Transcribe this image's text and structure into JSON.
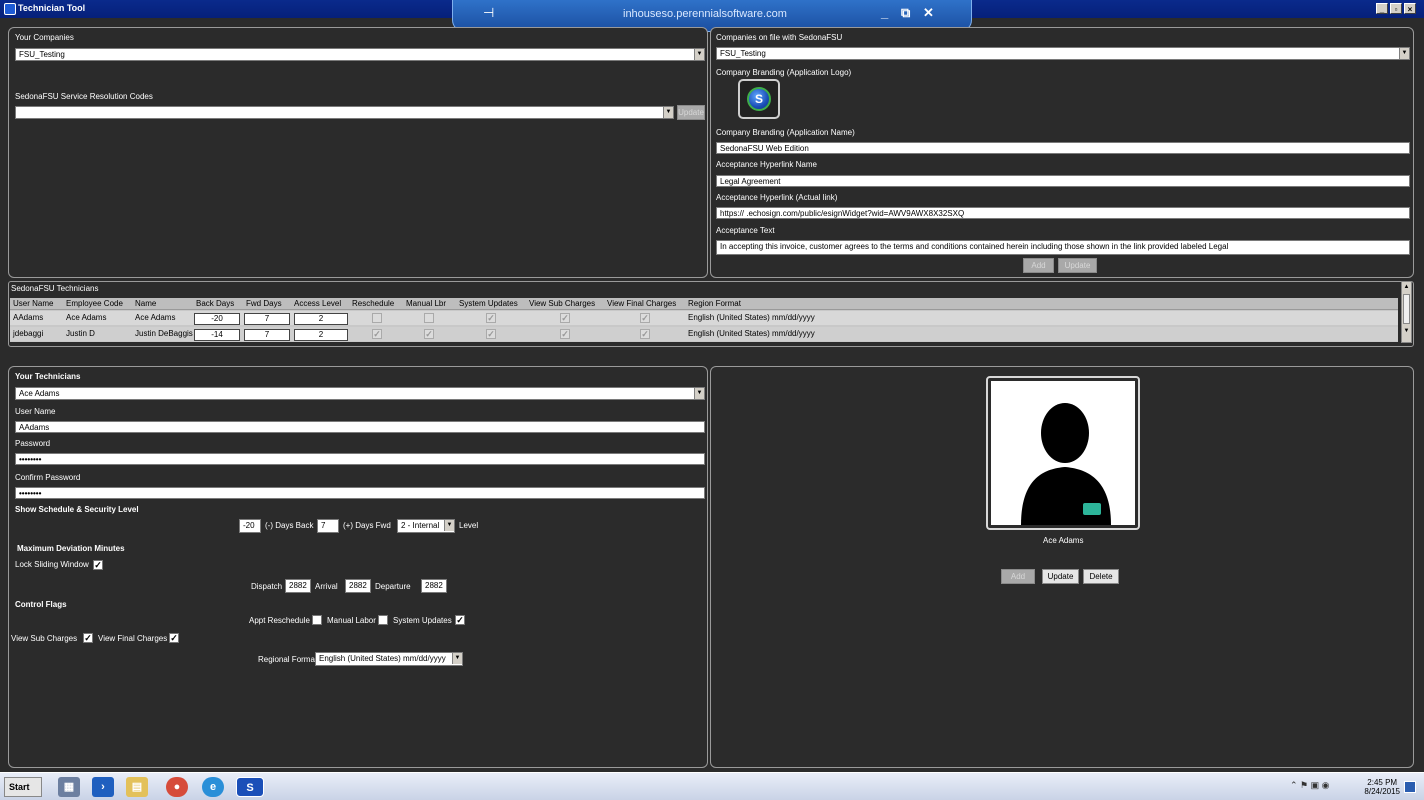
{
  "window": {
    "title": "Technician Tool",
    "remote_host": "inhouseso.perennialsoftware.com"
  },
  "left_top": {
    "companies_label": "Your Companies",
    "company_value": "FSU_Testing",
    "resolution_label": "SedonaFSU Service Resolution Codes",
    "resolution_value": "",
    "update_label": "Update"
  },
  "right_top": {
    "companies_label": "Companies on file with SedonaFSU",
    "company_value": "FSU_Testing",
    "logo_label": "Company Branding (Application Logo)",
    "logo_letter": "S",
    "appname_label": "Company Branding (Application Name)",
    "appname_value": "SedonaFSU Web Edition",
    "hyperlink_name_label": "Acceptance Hyperlink Name",
    "hyperlink_name_value": "Legal Agreement",
    "hyperlink_link_label": "Acceptance Hyperlink (Actual link)",
    "hyperlink_link_value": "https://                    .echosign.com/public/esignWidget?wid=AWV9AWX8X32SXQ",
    "acceptance_text_label": "Acceptance Text",
    "acceptance_text_value": " In accepting this invoice, customer agrees to the terms and conditions contained herein including those shown in the link provided labeled Legal",
    "add_label": "Add",
    "update_label": "Update"
  },
  "grid": {
    "title": "SedonaFSU Technicians",
    "headers": [
      "User Name",
      "Employee Code",
      "Name",
      "Back Days",
      "Fwd Days",
      "Access Level",
      "Reschedule",
      "Manual Lbr",
      "System Updates",
      "View Sub Charges",
      "View Final Charges",
      "Region Format"
    ],
    "rows": [
      {
        "user": "AAdams",
        "code": "Ace Adams",
        "name": "Ace Adams",
        "back": "-20",
        "fwd": "7",
        "access": "2",
        "region": "English (United States) mm/dd/yyyy"
      },
      {
        "user": "jdebaggi",
        "code": "Justin D",
        "name": "Justin DeBaggis",
        "back": "-14",
        "fwd": "7",
        "access": "2",
        "region": "English (United States) mm/dd/yyyy"
      }
    ]
  },
  "technician": {
    "your_techs_label": "Your Technicians",
    "tech_value": "Ace Adams",
    "username_label": "User Name",
    "username_value": "AAdams",
    "password_label": "Password",
    "password_value": "••••••••",
    "confirm_label": "Confirm Password",
    "confirm_value": "••••••••",
    "schedule_label": "Show Schedule & Security Level",
    "days_back_value": "-20",
    "days_back_label": "(-) Days Back",
    "days_fwd_value": "7",
    "days_fwd_label": "(+) Days Fwd",
    "level_value": "2 - Internal",
    "level_label": "Level",
    "deviation_label": "Maximum Deviation Minutes",
    "lock_label": "Lock Sliding Window",
    "dispatch_label": "Dispatch",
    "dispatch_value": "2882",
    "arrival_label": "Arrival",
    "arrival_value": "2882",
    "departure_label": "Departure",
    "departure_value": "2882",
    "flags_label": "Control Flags",
    "appt_label": "Appt Reschedule",
    "manual_label": "Manual Labor",
    "sysupd_label": "System Updates",
    "subcharges_label": "View Sub Charges",
    "finalcharges_label": "View Final Charges",
    "regional_label": "Regional Format",
    "regional_value": "English (United States) mm/dd/yyyy"
  },
  "profile": {
    "name": "Ace Adams",
    "add_label": "Add",
    "update_label": "Update",
    "delete_label": "Delete"
  },
  "taskbar": {
    "start_label": "Start",
    "time": "2:45 PM",
    "date": "8/24/2015"
  }
}
